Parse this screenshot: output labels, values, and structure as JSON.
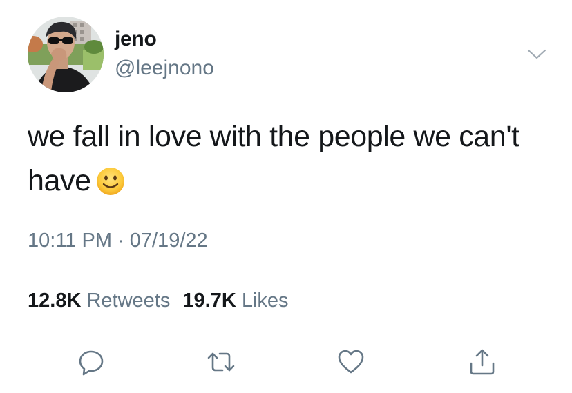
{
  "user": {
    "display_name": "jeno",
    "handle": "@leejnono"
  },
  "tweet": {
    "text_line1": "we fall in love with the people we can't",
    "text_line2": "have",
    "emoji": "slightly-smiling-face-emoji",
    "timestamp": "10:11 PM · 07/19/22"
  },
  "stats": {
    "retweets_count": "12.8K",
    "retweets_label": "Retweets",
    "likes_count": "19.7K",
    "likes_label": "Likes"
  },
  "actions": [
    "reply-icon",
    "retweet-icon",
    "like-icon",
    "share-icon"
  ],
  "colors": {
    "text": "#14171a",
    "secondary": "#657786",
    "divider": "#d7dde2",
    "icon": "#657786"
  }
}
